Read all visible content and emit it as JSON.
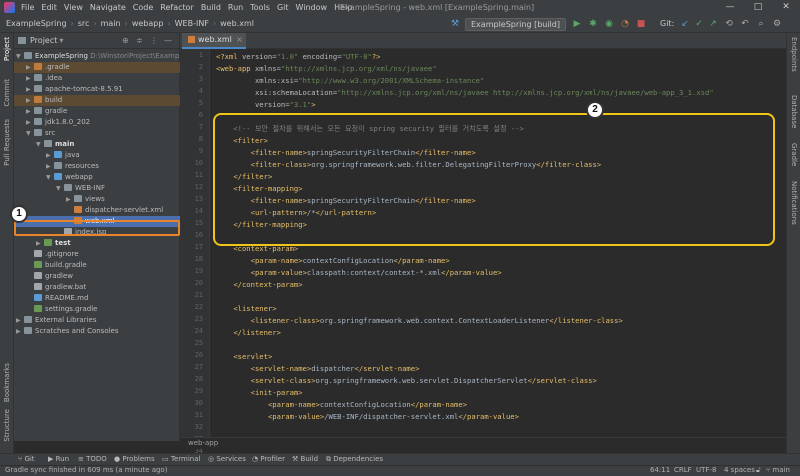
{
  "window": {
    "title": "ExampleSpring - web.xml [ExampleSpring.main]",
    "menu": [
      "File",
      "Edit",
      "View",
      "Navigate",
      "Code",
      "Refactor",
      "Build",
      "Run",
      "Tools",
      "Git",
      "Window",
      "Help"
    ],
    "controls": [
      "—",
      "□",
      "✕"
    ]
  },
  "breadcrumbs": [
    "ExampleSpring",
    "src",
    "main",
    "webapp",
    "WEB-INF",
    "web.xml"
  ],
  "toolbar": {
    "run_config": "ExampleSpring [build]",
    "git_label": "Git:"
  },
  "project": {
    "title": "Project",
    "items": [
      {
        "label": "ExampleSpring",
        "extra": "D:\\WinstoriProject\\ExampleSp"
      },
      {
        "label": ".gradle",
        "extra": ""
      },
      {
        "label": ".idea",
        "extra": ""
      },
      {
        "label": "apache-tomcat-8.5.91",
        "extra": ""
      },
      {
        "label": "build",
        "extra": ""
      },
      {
        "label": "gradle",
        "extra": ""
      },
      {
        "label": "jdk1.8.0_202",
        "extra": ""
      },
      {
        "label": "src",
        "extra": ""
      },
      {
        "label": "main",
        "extra": ""
      },
      {
        "label": "java",
        "extra": ""
      },
      {
        "label": "resources",
        "extra": ""
      },
      {
        "label": "webapp",
        "extra": ""
      },
      {
        "label": "WEB-INF",
        "extra": ""
      },
      {
        "label": "views",
        "extra": ""
      },
      {
        "label": "dispatcher-servlet.xml",
        "extra": ""
      },
      {
        "label": "web.xml",
        "extra": ""
      },
      {
        "label": "index.jsp",
        "extra": ""
      },
      {
        "label": "test",
        "extra": ""
      },
      {
        "label": ".gitignore",
        "extra": ""
      },
      {
        "label": "build.gradle",
        "extra": ""
      },
      {
        "label": "gradlew",
        "extra": ""
      },
      {
        "label": "gradlew.bat",
        "extra": ""
      },
      {
        "label": "README.md",
        "extra": ""
      },
      {
        "label": "settings.gradle",
        "extra": ""
      },
      {
        "label": "External Libraries",
        "extra": ""
      },
      {
        "label": "Scratches and Consoles",
        "extra": ""
      }
    ]
  },
  "left_tabs": [
    "Project",
    "Commit",
    "Pull Requests",
    "Bookmarks",
    "Structure"
  ],
  "right_tabs": [
    "Endpoints",
    "Database",
    "Gradle",
    "Notifications"
  ],
  "editor": {
    "tab": "web.xml",
    "footer": "web-app",
    "line_numbers": [
      "1",
      "2",
      "3",
      "4",
      "5",
      "6",
      "7",
      "8",
      "9",
      "10",
      "11",
      "12",
      "13",
      "14",
      "15",
      "16",
      "17",
      "18",
      "19",
      "20",
      "21",
      "22",
      "23",
      "24",
      "25",
      "26",
      "27",
      "28",
      "29",
      "30",
      "31",
      "32",
      "33",
      "34",
      "35"
    ],
    "lines": [
      "<?xml version=\"1.0\" encoding=\"UTF-8\"?>",
      "<web-app xmlns=\"http://xmlns.jcp.org/xml/ns/javaee\"",
      "         xmlns:xsi=\"http://www.w3.org/2001/XMLSchema-instance\"",
      "         xsi:schemaLocation=\"http://xmlns.jcp.org/xml/ns/javaee http://xmlns.jcp.org/xml/ns/javaee/web-app_3_1.xsd\"",
      "         version=\"3.1\">",
      "",
      "    <!-- 보안 절차를 위해서는 모든 요청이 spring security 필터를 거치도록 설정 -->",
      "    <filter>",
      "        <filter-name>springSecurityFilterChain</filter-name>",
      "        <filter-class>org.springframework.web.filter.DelegatingFilterProxy</filter-class>",
      "    </filter>",
      "    <filter-mapping>",
      "        <filter-name>springSecurityFilterChain</filter-name>",
      "        <url-pattern>/*</url-pattern>",
      "    </filter-mapping>",
      "",
      "    <context-param>",
      "        <param-name>contextConfigLocation</param-name>",
      "        <param-value>classpath:context/context-*.xml</param-value>",
      "    </context-param>",
      "",
      "    <listener>",
      "        <listener-class>org.springframework.web.context.ContextLoaderListener</listener-class>",
      "    </listener>",
      "",
      "    <servlet>",
      "        <servlet-name>dispatcher</servlet-name>",
      "        <servlet-class>org.springframework.web.servlet.DispatcherServlet</servlet-class>",
      "        <init-param>",
      "            <param-name>contextConfigLocation</param-name>",
      "            <param-value>/WEB-INF/dispatcher-servlet.xml</param-value>"
    ]
  },
  "bottom_tools": [
    "Git",
    "Run",
    "TODO",
    "Problems",
    "Terminal",
    "Services",
    "Profiler",
    "Build",
    "Dependencies"
  ],
  "status": {
    "message": "Gradle sync finished in 609 ms (a minute ago)",
    "position": "64:11",
    "line_sep": "CRLF",
    "encoding": "UTF-8",
    "indent": "4 spaces",
    "branch": "main"
  },
  "callouts": [
    "1",
    "2"
  ]
}
